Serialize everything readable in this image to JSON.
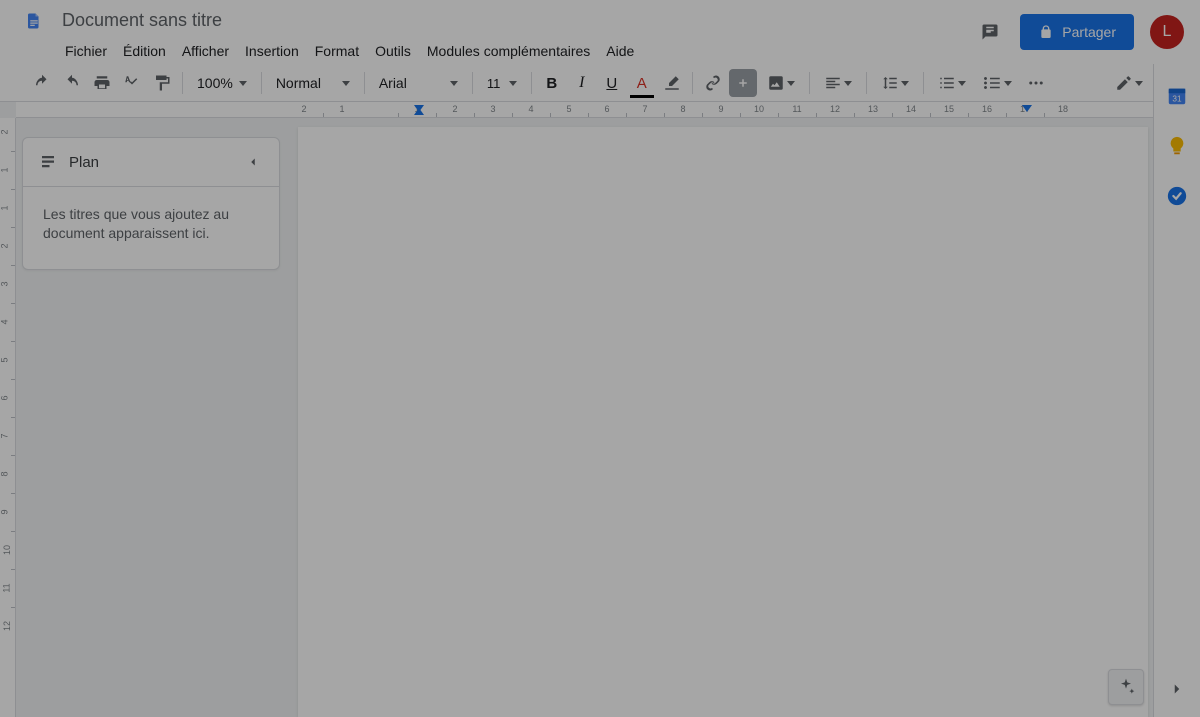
{
  "doc": {
    "title": "Document sans titre"
  },
  "menu": {
    "file": "Fichier",
    "edit": "Édition",
    "view": "Afficher",
    "insert": "Insertion",
    "format": "Format",
    "tools": "Outils",
    "addons": "Modules complémentaires",
    "help": "Aide"
  },
  "share": {
    "label": "Partager"
  },
  "avatar": {
    "initial": "L"
  },
  "toolbar": {
    "zoom": "100%",
    "style": "Normal",
    "font": "Arial",
    "size": "11"
  },
  "outline": {
    "title": "Plan",
    "empty": "Les titres que vous ajoutez au document apparaissent ici."
  },
  "ruler": {
    "h": [
      "2",
      "1",
      "1",
      "2",
      "3",
      "4",
      "5",
      "6",
      "7",
      "8",
      "9",
      "10",
      "11",
      "12",
      "13",
      "14",
      "15",
      "16",
      "17",
      "18"
    ],
    "v": [
      "2",
      "1",
      "1",
      "2",
      "3",
      "4",
      "5",
      "6",
      "7",
      "8",
      "9",
      "10",
      "11",
      "12"
    ]
  },
  "rail": {
    "calendar_badge": "31"
  }
}
